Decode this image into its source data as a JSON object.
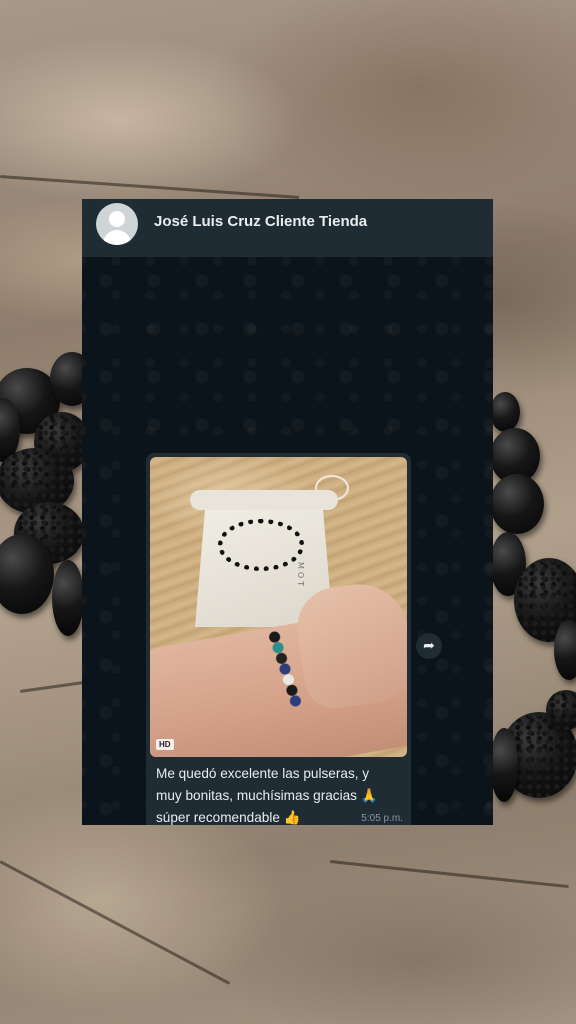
{
  "chat": {
    "contact_name": "José Luis Cruz Cliente Tienda",
    "photo_badge": "HD",
    "pouch_label": "MOT",
    "message_text": "Me quedó excelente las pulseras, y\nmuy bonitas, muchísimas gracias 🙏\nsúper recomendable 👍",
    "timestamp": "5:05 p.m.",
    "reaction": "❤️",
    "forward_icon": "➦"
  },
  "colors": {
    "header_bg": "#1f2c34",
    "wallpaper_bg": "#0b141a",
    "bubble_bg": "#1f2c34",
    "text": "#e9edef",
    "timestamp": "#8696a0"
  }
}
